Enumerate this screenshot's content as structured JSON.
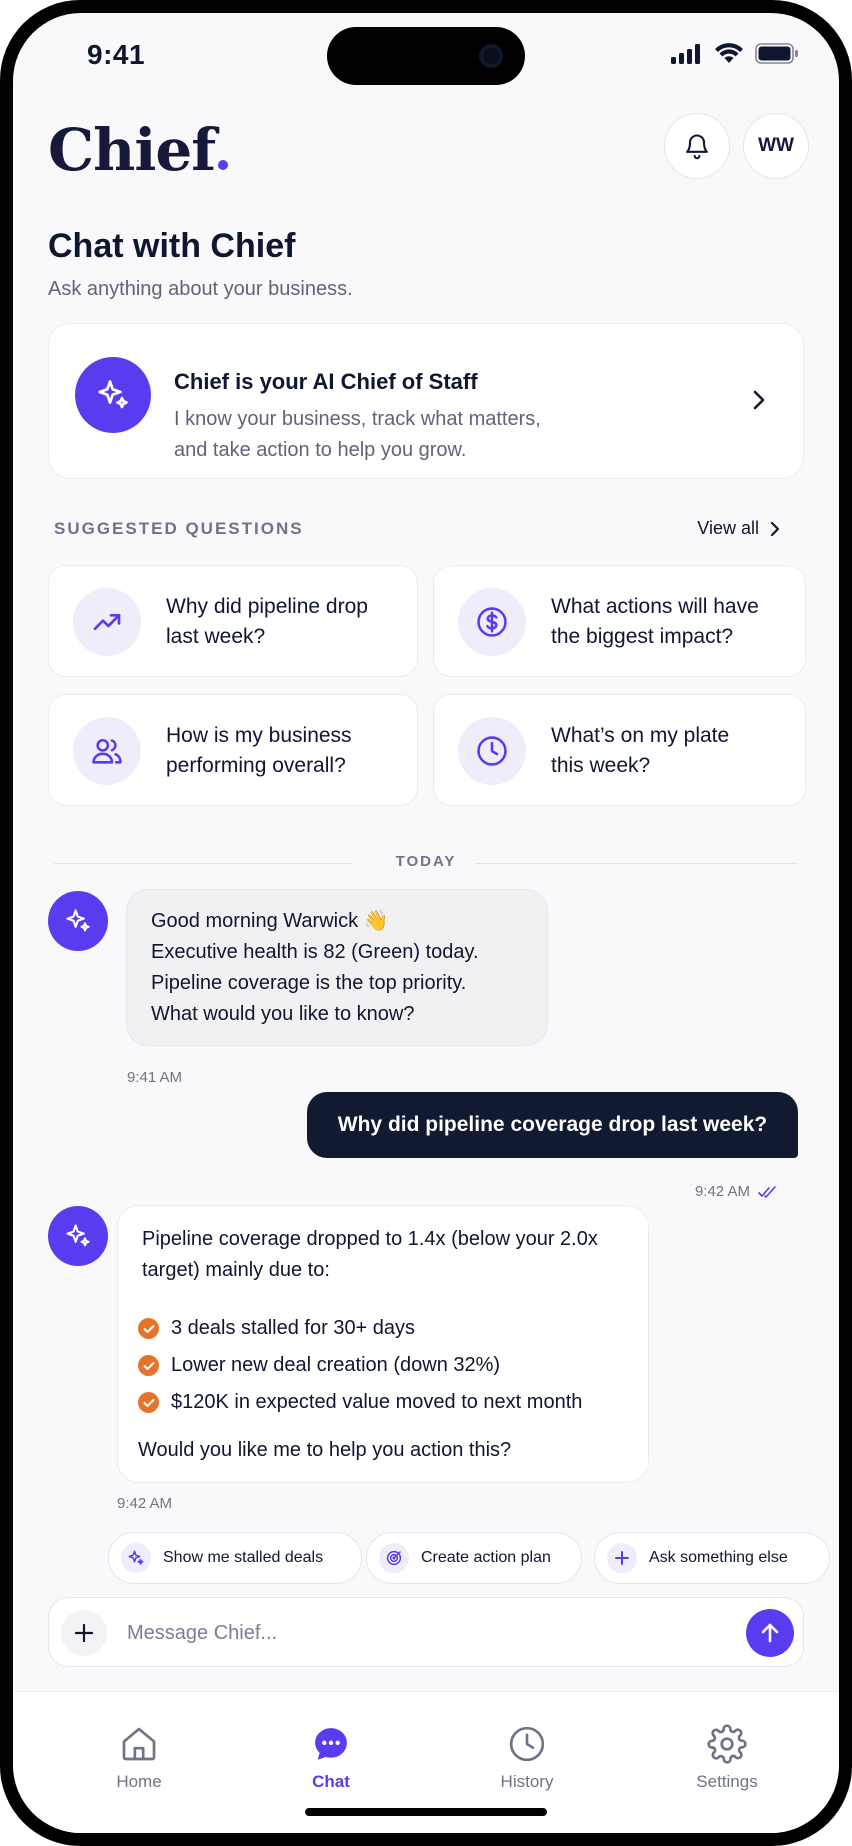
{
  "status_bar": {
    "time": "9:41"
  },
  "header": {
    "logo_text": "Chief",
    "avatar_initials": "WW",
    "icons": [
      "bell-icon"
    ]
  },
  "page": {
    "title": "Chat with Chief",
    "subtitle": "Ask anything about your business."
  },
  "intro_card": {
    "heading": "Chief is your AI Chief of Staff",
    "line1": "I know your business, track what matters,",
    "line2": "and take action to help you grow."
  },
  "suggested": {
    "label": "SUGGESTED QUESTIONS",
    "view_all": "View all",
    "questions": [
      {
        "line1": "Why did pipeline drop",
        "line2": "last week?",
        "icon": "trending-up-icon"
      },
      {
        "line1": "What actions will have",
        "line2": "the biggest impact?",
        "icon": "dollar-icon"
      },
      {
        "line1": "How is my business",
        "line2": "performing overall?",
        "icon": "users-icon"
      },
      {
        "line1": "What’s on my plate",
        "line2": "this week?",
        "icon": "clock-icon"
      }
    ]
  },
  "divider": {
    "label": "TODAY"
  },
  "messages": {
    "bot1": {
      "lines": [
        "Good morning Warwick 👋",
        "Executive health is 82 (Green) today.",
        "Pipeline coverage is the top priority.",
        "What would you like to know?"
      ],
      "time": "9:41 AM"
    },
    "user1": {
      "text": "Why did pipeline coverage drop last week?",
      "time": "9:42 AM"
    },
    "bot2": {
      "intro": "Pipeline coverage dropped to 1.4x (below your 2.0x target) mainly due to:",
      "bullets": [
        "3 deals stalled for 30+ days",
        "Lower new deal creation (down 32%)",
        "$120K in expected value moved to next month"
      ],
      "question": "Would you like me to help you action this?",
      "time": "9:42 AM"
    }
  },
  "chips": [
    {
      "label": "Show me stalled deals",
      "icon": "sparkle-icon"
    },
    {
      "label": "Create action plan",
      "icon": "target-icon"
    },
    {
      "label": "Ask something else",
      "icon": "plus-icon"
    }
  ],
  "composer": {
    "placeholder": "Message Chief..."
  },
  "tabs": [
    {
      "label": "Home",
      "icon": "home-icon"
    },
    {
      "label": "Chat",
      "icon": "chat-icon",
      "active": true
    },
    {
      "label": "History",
      "icon": "clock-icon"
    },
    {
      "label": "Settings",
      "icon": "gear-icon"
    }
  ],
  "colors": {
    "accent": "#5a3cf0",
    "navy": "#111a30",
    "check": "#e57328",
    "muted": "#6e7387"
  }
}
